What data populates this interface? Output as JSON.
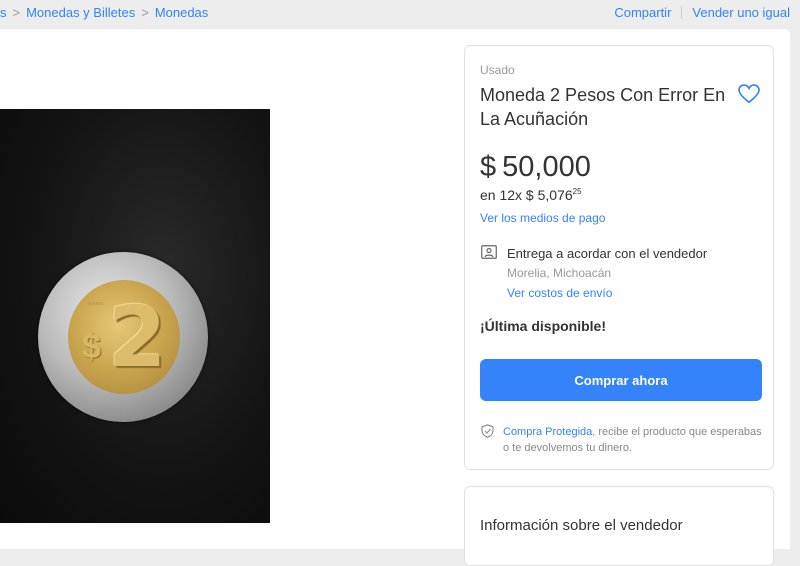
{
  "breadcrumb": {
    "items": [
      "s",
      "Monedas y Billetes",
      "Monedas"
    ],
    "separator": ">"
  },
  "top_actions": {
    "share": "Compartir",
    "sell_same": "Vender uno igual"
  },
  "product": {
    "condition": "Usado",
    "title": "Moneda 2 Pesos Con Error En La Acuñación",
    "currency": "$",
    "price": "50,000",
    "installments_prefix": "en 12x $ 5,076",
    "installments_cents": "25",
    "payment_link": "Ver los medios de pago",
    "delivery": "Entrega a acordar con el vendedor",
    "location": "Morelia, Michoacán",
    "shipping_link": "Ver costos de envío",
    "stock_notice": "¡Última disponible!",
    "buy_button": "Comprar ahora",
    "protection_link": "Compra Protegida",
    "protection_text": ", recibe el producto que esperabas o te devolvemos tu dinero."
  },
  "image": {
    "coin_digit": "2",
    "coin_sign": "$"
  },
  "seller": {
    "title": "Información sobre el vendedor"
  },
  "icons": {
    "favorite": "heart-icon",
    "delivery": "person-card-icon",
    "protection": "shield-icon"
  },
  "colors": {
    "accent": "#3483fa",
    "background": "#ededed",
    "text": "#333333",
    "muted": "#999999"
  }
}
